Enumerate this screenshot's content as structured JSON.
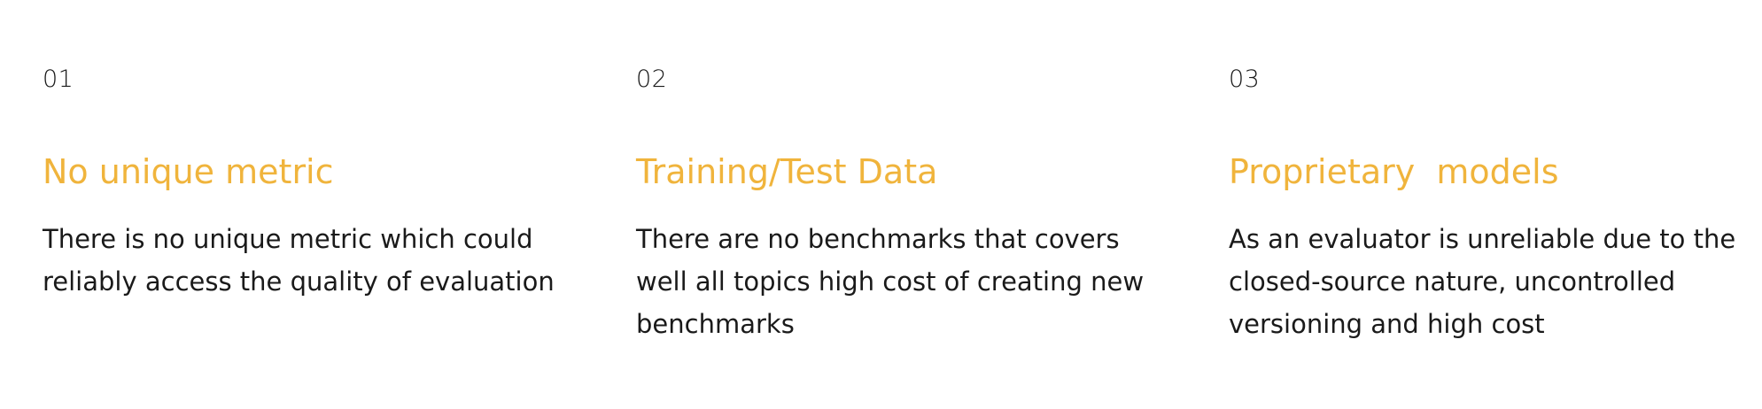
{
  "colors": {
    "accent": "#F0B43C",
    "text": "#1a1a1a",
    "background": "#ffffff"
  },
  "cards": [
    {
      "number": "01",
      "title": "No unique metric",
      "description": "There is no unique metric which could reliably access the quality of evaluation"
    },
    {
      "number": "02",
      "title": "Training/Test Data",
      "description": "There are no benchmarks that covers well all topics high cost of creating new benchmarks"
    },
    {
      "number": "03",
      "title": "Proprietary  models",
      "description": "As an evaluator is unreliable due to the closed-source nature, uncontrolled versioning and high cost"
    }
  ]
}
